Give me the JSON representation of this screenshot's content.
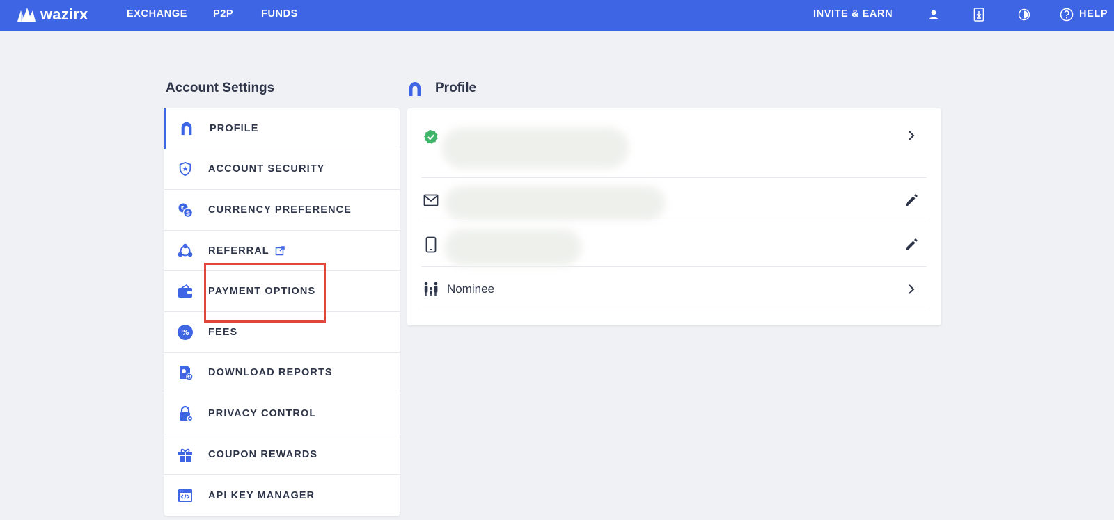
{
  "topbar": {
    "logo_text": "wazirx",
    "nav": [
      {
        "label": "EXCHANGE"
      },
      {
        "label": "P2P"
      },
      {
        "label": "FUNDS"
      }
    ],
    "invite_label": "INVITE & EARN",
    "help_label": "HELP",
    "icons": [
      "user-icon",
      "download-app-icon",
      "theme-toggle-icon",
      "help-icon"
    ]
  },
  "sidebar": {
    "title": "Account Settings",
    "items": [
      {
        "label": "PROFILE",
        "icon": "profile-icon",
        "active": true
      },
      {
        "label": "ACCOUNT SECURITY",
        "icon": "shield-star-icon"
      },
      {
        "label": "CURRENCY PREFERENCE",
        "icon": "currency-icon"
      },
      {
        "label": "REFERRAL",
        "icon": "referral-icon",
        "external": true
      },
      {
        "label": "PAYMENT OPTIONS",
        "icon": "wallet-icon"
      },
      {
        "label": "FEES",
        "icon": "percent-icon"
      },
      {
        "label": "DOWNLOAD REPORTS",
        "icon": "report-icon"
      },
      {
        "label": "PRIVACY CONTROL",
        "icon": "lock-gear-icon"
      },
      {
        "label": "COUPON REWARDS",
        "icon": "gift-icon"
      },
      {
        "label": "API KEY MANAGER",
        "icon": "api-key-icon"
      }
    ]
  },
  "profile": {
    "title": "Profile",
    "nominee_label": "Nominee"
  },
  "colors": {
    "brand": "#3d65e4",
    "background": "#f0f1f5",
    "highlight": "#e2453a",
    "verified": "#3fb56a"
  }
}
